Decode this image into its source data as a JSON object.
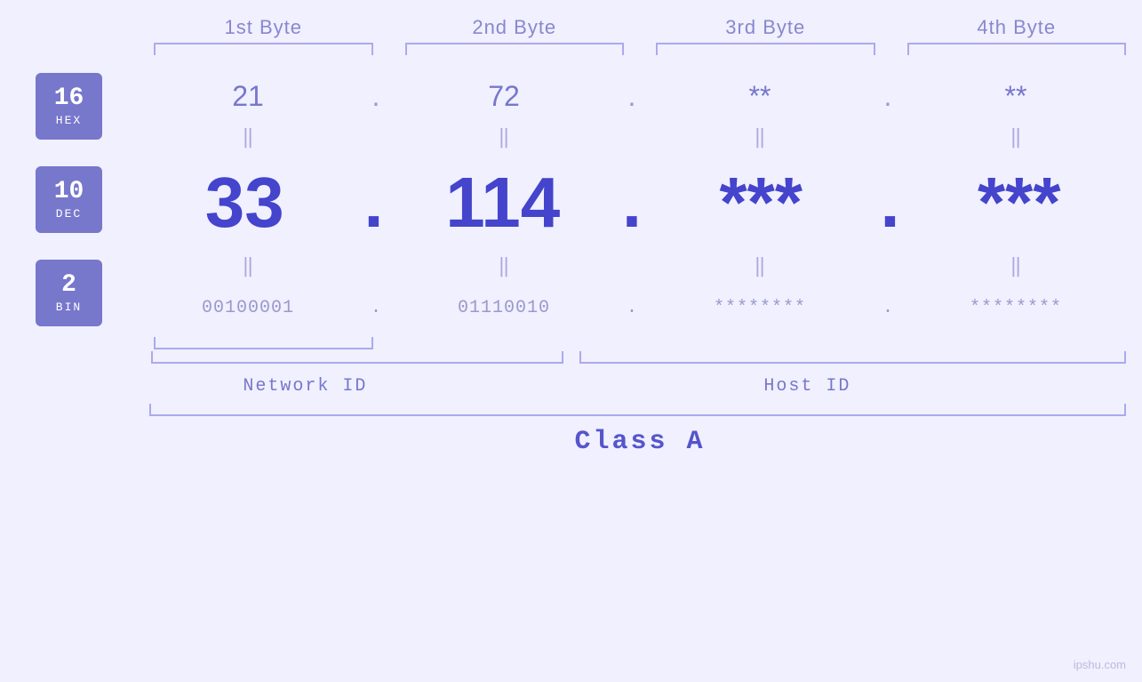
{
  "header": {
    "byte1": "1st Byte",
    "byte2": "2nd Byte",
    "byte3": "3rd Byte",
    "byte4": "4th Byte"
  },
  "badges": {
    "hex": {
      "num": "16",
      "label": "HEX"
    },
    "dec": {
      "num": "10",
      "label": "DEC"
    },
    "bin": {
      "num": "2",
      "label": "BIN"
    }
  },
  "hex_row": {
    "b1": "21",
    "b2": "72",
    "b3": "**",
    "b4": "**",
    "d1": ".",
    "d2": ".",
    "d3": ".",
    "d4": ""
  },
  "dec_row": {
    "b1": "33",
    "b2": "114.",
    "b3": "***.",
    "b4": "***",
    "d1": ".",
    "d2": "",
    "d3": "",
    "d4": ""
  },
  "bin_row": {
    "b1": "00100001",
    "b2": "01110010",
    "b3": "********",
    "b4": "********",
    "d1": ".",
    "d2": ".",
    "d3": ".",
    "d4": ""
  },
  "labels": {
    "network_id": "Network ID",
    "host_id": "Host ID",
    "class": "Class A"
  },
  "watermark": "ipshu.com",
  "colors": {
    "badge_bg": "#7777cc",
    "accent": "#5555cc",
    "muted": "#aaaaee",
    "text_hex": "#7777cc",
    "text_dec": "#4444cc",
    "text_bin": "#9999cc"
  }
}
